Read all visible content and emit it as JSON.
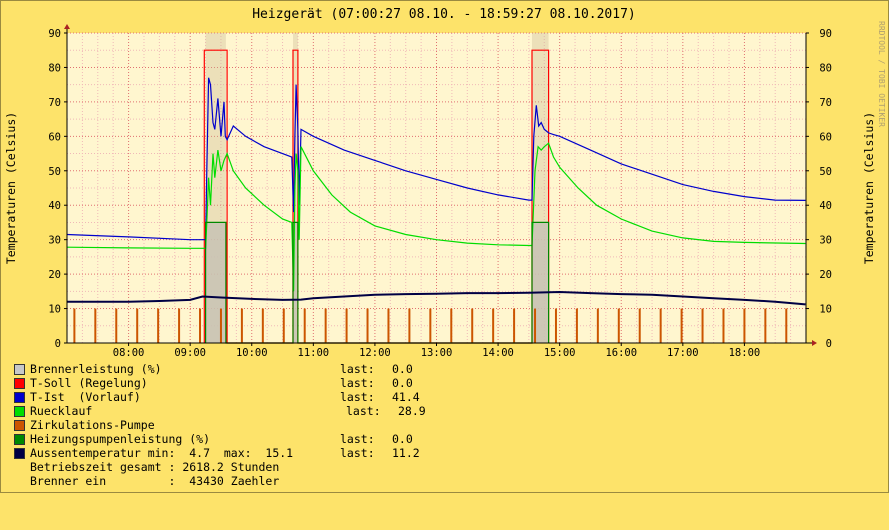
{
  "chart_data": {
    "type": "line",
    "title": "Heizgerät (07:00:27 08.10. - 18:59:27 08.10.2017)",
    "ylabel_left": "Temperaturen (Celsius)",
    "ylabel_right": "Temperaturen (Celsius)",
    "watermark": "RRDTOOL / TOBI OETIKER",
    "ylim": [
      0,
      90
    ],
    "yticks": [
      0,
      10,
      20,
      30,
      40,
      50,
      60,
      70,
      80,
      90
    ],
    "xlim": [
      "07:00",
      "19:00"
    ],
    "xticks": [
      "08:00",
      "09:00",
      "10:00",
      "11:00",
      "12:00",
      "13:00",
      "14:00",
      "15:00",
      "16:00",
      "17:00",
      "18:00"
    ],
    "grid": true,
    "series": [
      {
        "name": "Brennerleistung (%)",
        "color": "#c8c8c8",
        "style": "area",
        "points": [
          [
            9.25,
            0
          ],
          [
            9.25,
            35
          ],
          [
            9.58,
            35
          ],
          [
            9.58,
            0
          ],
          [
            10.67,
            0
          ],
          [
            10.67,
            35
          ],
          [
            10.75,
            35
          ],
          [
            10.75,
            0
          ],
          [
            14.55,
            0
          ],
          [
            14.55,
            35
          ],
          [
            14.82,
            35
          ],
          [
            14.82,
            0
          ]
        ]
      },
      {
        "name": "T-Soll (Regelung)",
        "color": "#ff0000",
        "style": "step",
        "points": [
          [
            9.23,
            0
          ],
          [
            9.23,
            85
          ],
          [
            9.6,
            85
          ],
          [
            9.6,
            0
          ],
          [
            10.67,
            0
          ],
          [
            10.67,
            85
          ],
          [
            10.75,
            85
          ],
          [
            10.75,
            0
          ],
          [
            14.55,
            0
          ],
          [
            14.55,
            85
          ],
          [
            14.82,
            85
          ],
          [
            14.82,
            0
          ]
        ]
      },
      {
        "name": "T-Ist  (Vorlauf)",
        "color": "#0000cc",
        "style": "line",
        "points": [
          [
            7.0,
            31.5
          ],
          [
            8.0,
            30.8
          ],
          [
            9.0,
            30.0
          ],
          [
            9.25,
            30.0
          ],
          [
            9.27,
            50
          ],
          [
            9.3,
            77
          ],
          [
            9.33,
            75
          ],
          [
            9.37,
            64
          ],
          [
            9.4,
            62
          ],
          [
            9.45,
            71
          ],
          [
            9.5,
            60
          ],
          [
            9.55,
            70
          ],
          [
            9.57,
            60
          ],
          [
            9.6,
            59
          ],
          [
            9.7,
            63
          ],
          [
            9.9,
            60
          ],
          [
            10.2,
            57
          ],
          [
            10.5,
            55
          ],
          [
            10.65,
            54
          ],
          [
            10.68,
            38
          ],
          [
            10.7,
            60
          ],
          [
            10.72,
            75
          ],
          [
            10.75,
            62
          ],
          [
            10.77,
            40
          ],
          [
            10.8,
            62
          ],
          [
            11.0,
            60
          ],
          [
            11.5,
            56
          ],
          [
            12.0,
            53
          ],
          [
            12.5,
            50
          ],
          [
            13.0,
            47.5
          ],
          [
            13.5,
            45
          ],
          [
            14.0,
            43
          ],
          [
            14.5,
            41.5
          ],
          [
            14.55,
            41.5
          ],
          [
            14.58,
            60
          ],
          [
            14.62,
            69
          ],
          [
            14.66,
            63
          ],
          [
            14.7,
            64
          ],
          [
            14.75,
            62
          ],
          [
            14.82,
            61
          ],
          [
            14.9,
            60.5
          ],
          [
            15.0,
            60
          ],
          [
            15.5,
            56
          ],
          [
            16.0,
            52
          ],
          [
            16.5,
            49
          ],
          [
            17.0,
            46
          ],
          [
            17.5,
            44
          ],
          [
            18.0,
            42.5
          ],
          [
            18.5,
            41.5
          ],
          [
            18.99,
            41.4
          ]
        ]
      },
      {
        "name": "Ruecklauf",
        "color": "#00dd00",
        "style": "line",
        "points": [
          [
            7.0,
            27.8
          ],
          [
            8.0,
            27.6
          ],
          [
            9.0,
            27.5
          ],
          [
            9.25,
            27.5
          ],
          [
            9.27,
            35
          ],
          [
            9.3,
            48
          ],
          [
            9.33,
            40
          ],
          [
            9.37,
            55
          ],
          [
            9.4,
            48
          ],
          [
            9.45,
            56
          ],
          [
            9.5,
            50
          ],
          [
            9.55,
            53
          ],
          [
            9.6,
            55
          ],
          [
            9.7,
            50
          ],
          [
            9.9,
            45
          ],
          [
            10.2,
            40
          ],
          [
            10.5,
            36
          ],
          [
            10.65,
            35
          ],
          [
            10.68,
            15
          ],
          [
            10.7,
            45
          ],
          [
            10.72,
            55
          ],
          [
            10.75,
            50
          ],
          [
            10.77,
            30
          ],
          [
            10.8,
            57
          ],
          [
            11.0,
            50
          ],
          [
            11.3,
            43
          ],
          [
            11.6,
            38
          ],
          [
            12.0,
            34
          ],
          [
            12.5,
            31.5
          ],
          [
            13.0,
            30
          ],
          [
            13.5,
            29
          ],
          [
            14.0,
            28.5
          ],
          [
            14.5,
            28.3
          ],
          [
            14.55,
            28.3
          ],
          [
            14.6,
            50
          ],
          [
            14.65,
            57
          ],
          [
            14.7,
            56
          ],
          [
            14.75,
            57
          ],
          [
            14.82,
            58
          ],
          [
            14.9,
            54
          ],
          [
            15.0,
            51
          ],
          [
            15.3,
            45
          ],
          [
            15.6,
            40
          ],
          [
            16.0,
            36
          ],
          [
            16.5,
            32.5
          ],
          [
            17.0,
            30.5
          ],
          [
            17.5,
            29.5
          ],
          [
            18.0,
            29.2
          ],
          [
            18.99,
            28.9
          ]
        ]
      },
      {
        "name": "Zirkulations-Pumpe",
        "color": "#cc5500",
        "style": "pulses",
        "start": 7.12,
        "step": 0.34,
        "end": 18.99,
        "height": 10
      },
      {
        "name": "Heizungspumpenleistung (%)",
        "color": "#008800",
        "style": "step",
        "points": [
          [
            9.25,
            0
          ],
          [
            9.25,
            35
          ],
          [
            9.58,
            35
          ],
          [
            9.58,
            0
          ],
          [
            10.67,
            0
          ],
          [
            10.67,
            35
          ],
          [
            10.75,
            35
          ],
          [
            10.75,
            0
          ],
          [
            14.55,
            0
          ],
          [
            14.55,
            35
          ],
          [
            14.82,
            35
          ],
          [
            14.82,
            0
          ]
        ]
      },
      {
        "name": "Aussentemperatur",
        "color": "#000044",
        "style": "line",
        "points": [
          [
            7.0,
            12
          ],
          [
            8.0,
            12
          ],
          [
            8.5,
            12.2
          ],
          [
            9.0,
            12.5
          ],
          [
            9.2,
            13.5
          ],
          [
            9.5,
            13.2
          ],
          [
            10.0,
            12.8
          ],
          [
            10.5,
            12.5
          ],
          [
            10.8,
            12.6
          ],
          [
            11.0,
            13.0
          ],
          [
            11.5,
            13.5
          ],
          [
            12.0,
            14.0
          ],
          [
            12.5,
            14.2
          ],
          [
            13.0,
            14.3
          ],
          [
            13.5,
            14.5
          ],
          [
            14.0,
            14.5
          ],
          [
            14.5,
            14.6
          ],
          [
            15.0,
            14.8
          ],
          [
            15.5,
            14.5
          ],
          [
            16.0,
            14.2
          ],
          [
            16.5,
            14.0
          ],
          [
            17.0,
            13.5
          ],
          [
            17.5,
            13.0
          ],
          [
            18.0,
            12.5
          ],
          [
            18.5,
            12.0
          ],
          [
            18.99,
            11.2
          ]
        ]
      }
    ]
  },
  "legend": [
    {
      "name": "Brennerleistung (%)",
      "last_label": "last:",
      "last": "0.0",
      "color": "#c8c8c8"
    },
    {
      "name": "T-Soll (Regelung)",
      "last_label": "last:",
      "last": "0.0",
      "color": "#ff0000"
    },
    {
      "name": "T-Ist  (Vorlauf)",
      "last_label": "last:",
      "last": "41.4",
      "color": "#0000cc"
    },
    {
      "name": "Ruecklauf",
      "last_label": "last:",
      "last": "28.9",
      "color": "#00dd00"
    },
    {
      "name": "Zirkulations-Pumpe",
      "last_label": "",
      "last": "",
      "color": "#cc5500"
    },
    {
      "name": "Heizungspumpenleistung (%)",
      "last_label": "last:",
      "last": "0.0",
      "color": "#008800"
    },
    {
      "name": "Aussentemperatur min:  4.7  max:  15.1",
      "last_label": "last:",
      "last": "11.2",
      "color": "#000044"
    }
  ],
  "info": [
    "Betriebszeit gesamt : 2618.2 Stunden",
    "Brenner ein         :  43430 Zaehler"
  ]
}
